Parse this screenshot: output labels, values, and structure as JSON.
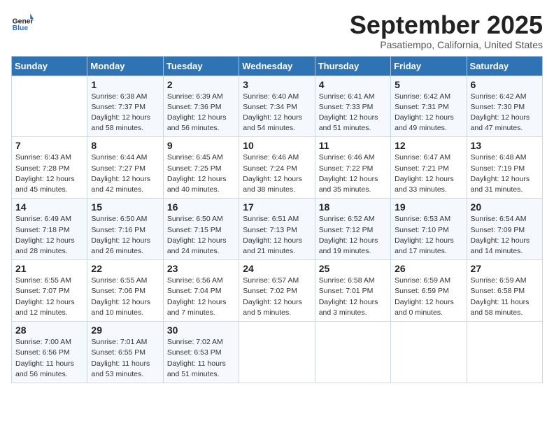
{
  "logo": {
    "line1": "General",
    "line2": "Blue"
  },
  "title": "September 2025",
  "subtitle": "Pasatiempo, California, United States",
  "headers": [
    "Sunday",
    "Monday",
    "Tuesday",
    "Wednesday",
    "Thursday",
    "Friday",
    "Saturday"
  ],
  "weeks": [
    [
      {
        "num": "",
        "info": ""
      },
      {
        "num": "1",
        "info": "Sunrise: 6:38 AM\nSunset: 7:37 PM\nDaylight: 12 hours\nand 58 minutes."
      },
      {
        "num": "2",
        "info": "Sunrise: 6:39 AM\nSunset: 7:36 PM\nDaylight: 12 hours\nand 56 minutes."
      },
      {
        "num": "3",
        "info": "Sunrise: 6:40 AM\nSunset: 7:34 PM\nDaylight: 12 hours\nand 54 minutes."
      },
      {
        "num": "4",
        "info": "Sunrise: 6:41 AM\nSunset: 7:33 PM\nDaylight: 12 hours\nand 51 minutes."
      },
      {
        "num": "5",
        "info": "Sunrise: 6:42 AM\nSunset: 7:31 PM\nDaylight: 12 hours\nand 49 minutes."
      },
      {
        "num": "6",
        "info": "Sunrise: 6:42 AM\nSunset: 7:30 PM\nDaylight: 12 hours\nand 47 minutes."
      }
    ],
    [
      {
        "num": "7",
        "info": "Sunrise: 6:43 AM\nSunset: 7:28 PM\nDaylight: 12 hours\nand 45 minutes."
      },
      {
        "num": "8",
        "info": "Sunrise: 6:44 AM\nSunset: 7:27 PM\nDaylight: 12 hours\nand 42 minutes."
      },
      {
        "num": "9",
        "info": "Sunrise: 6:45 AM\nSunset: 7:25 PM\nDaylight: 12 hours\nand 40 minutes."
      },
      {
        "num": "10",
        "info": "Sunrise: 6:46 AM\nSunset: 7:24 PM\nDaylight: 12 hours\nand 38 minutes."
      },
      {
        "num": "11",
        "info": "Sunrise: 6:46 AM\nSunset: 7:22 PM\nDaylight: 12 hours\nand 35 minutes."
      },
      {
        "num": "12",
        "info": "Sunrise: 6:47 AM\nSunset: 7:21 PM\nDaylight: 12 hours\nand 33 minutes."
      },
      {
        "num": "13",
        "info": "Sunrise: 6:48 AM\nSunset: 7:19 PM\nDaylight: 12 hours\nand 31 minutes."
      }
    ],
    [
      {
        "num": "14",
        "info": "Sunrise: 6:49 AM\nSunset: 7:18 PM\nDaylight: 12 hours\nand 28 minutes."
      },
      {
        "num": "15",
        "info": "Sunrise: 6:50 AM\nSunset: 7:16 PM\nDaylight: 12 hours\nand 26 minutes."
      },
      {
        "num": "16",
        "info": "Sunrise: 6:50 AM\nSunset: 7:15 PM\nDaylight: 12 hours\nand 24 minutes."
      },
      {
        "num": "17",
        "info": "Sunrise: 6:51 AM\nSunset: 7:13 PM\nDaylight: 12 hours\nand 21 minutes."
      },
      {
        "num": "18",
        "info": "Sunrise: 6:52 AM\nSunset: 7:12 PM\nDaylight: 12 hours\nand 19 minutes."
      },
      {
        "num": "19",
        "info": "Sunrise: 6:53 AM\nSunset: 7:10 PM\nDaylight: 12 hours\nand 17 minutes."
      },
      {
        "num": "20",
        "info": "Sunrise: 6:54 AM\nSunset: 7:09 PM\nDaylight: 12 hours\nand 14 minutes."
      }
    ],
    [
      {
        "num": "21",
        "info": "Sunrise: 6:55 AM\nSunset: 7:07 PM\nDaylight: 12 hours\nand 12 minutes."
      },
      {
        "num": "22",
        "info": "Sunrise: 6:55 AM\nSunset: 7:06 PM\nDaylight: 12 hours\nand 10 minutes."
      },
      {
        "num": "23",
        "info": "Sunrise: 6:56 AM\nSunset: 7:04 PM\nDaylight: 12 hours\nand 7 minutes."
      },
      {
        "num": "24",
        "info": "Sunrise: 6:57 AM\nSunset: 7:02 PM\nDaylight: 12 hours\nand 5 minutes."
      },
      {
        "num": "25",
        "info": "Sunrise: 6:58 AM\nSunset: 7:01 PM\nDaylight: 12 hours\nand 3 minutes."
      },
      {
        "num": "26",
        "info": "Sunrise: 6:59 AM\nSunset: 6:59 PM\nDaylight: 12 hours\nand 0 minutes."
      },
      {
        "num": "27",
        "info": "Sunrise: 6:59 AM\nSunset: 6:58 PM\nDaylight: 11 hours\nand 58 minutes."
      }
    ],
    [
      {
        "num": "28",
        "info": "Sunrise: 7:00 AM\nSunset: 6:56 PM\nDaylight: 11 hours\nand 56 minutes."
      },
      {
        "num": "29",
        "info": "Sunrise: 7:01 AM\nSunset: 6:55 PM\nDaylight: 11 hours\nand 53 minutes."
      },
      {
        "num": "30",
        "info": "Sunrise: 7:02 AM\nSunset: 6:53 PM\nDaylight: 11 hours\nand 51 minutes."
      },
      {
        "num": "",
        "info": ""
      },
      {
        "num": "",
        "info": ""
      },
      {
        "num": "",
        "info": ""
      },
      {
        "num": "",
        "info": ""
      }
    ]
  ]
}
